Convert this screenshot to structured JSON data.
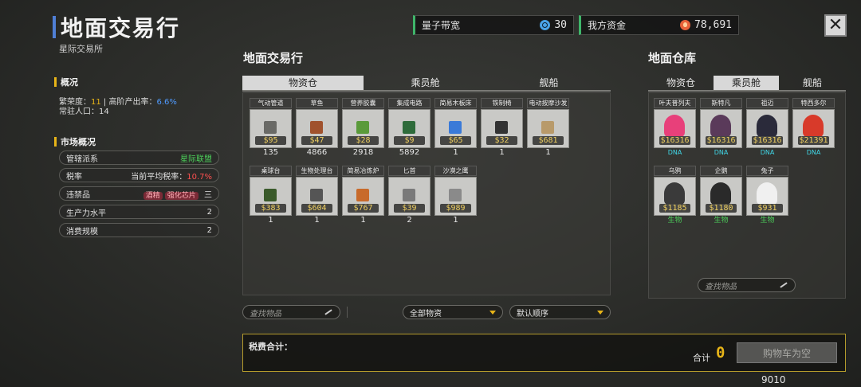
{
  "header": {
    "title": "地面交易行",
    "subtitle": "星际交易所"
  },
  "overview": {
    "heading": "概况",
    "prosperity_label": "繁荣度：",
    "prosperity_value": "11",
    "separator": "|",
    "high_rate_label": "高阶产出率：",
    "high_rate_value": "6.6%",
    "population_label": "常驻人口：",
    "population_value": "14"
  },
  "market": {
    "heading": "市场概况",
    "rows": [
      {
        "label": "管辖派系",
        "value": "星际联盟"
      },
      {
        "label": "税率",
        "value_label": "当前平均税率：",
        "value": "10.7%"
      },
      {
        "label": "违禁品",
        "tags": [
          "酒精",
          "强化芯片"
        ],
        "extra": "三"
      },
      {
        "label": "生产力水平",
        "value": "2"
      },
      {
        "label": "消费规模",
        "value": "2"
      }
    ]
  },
  "topbar": {
    "bandwidth_label": "量子带宽",
    "bandwidth_value": "30",
    "funds_label": "我方资金",
    "funds_value": "78,691",
    "close_glyph": "✕"
  },
  "exchange": {
    "title": "地面交易行",
    "tabs": [
      "物资仓",
      "乘员舱",
      "舰船"
    ],
    "active_tab": 0,
    "items": [
      {
        "name": "气动管道",
        "price": "$95",
        "qty": "135",
        "icon": "pipe-icon",
        "color": "#6a6a66"
      },
      {
        "name": "草鱼",
        "price": "$47",
        "qty": "4866",
        "icon": "fish-icon",
        "color": "#a0522d"
      },
      {
        "name": "营养胶囊",
        "price": "$28",
        "qty": "2918",
        "icon": "capsule-icon",
        "color": "#5a9a3a"
      },
      {
        "name": "集成电路",
        "price": "$9",
        "qty": "5892",
        "icon": "chip-icon",
        "color": "#2e6b3a"
      },
      {
        "name": "简易木板床",
        "price": "$65",
        "qty": "1",
        "icon": "bed-icon",
        "color": "#3a7ad8"
      },
      {
        "name": "铁制椅",
        "price": "$32",
        "qty": "1",
        "icon": "chair-icon",
        "color": "#333333"
      },
      {
        "name": "电动按摩沙发",
        "price": "$681",
        "qty": "1",
        "icon": "sofa-icon",
        "color": "#b89a6a"
      },
      {
        "name": "桌球台",
        "price": "$383",
        "qty": "1",
        "icon": "pool-table-icon",
        "color": "#3a5a2a"
      },
      {
        "name": "生物处理台",
        "price": "$604",
        "qty": "1",
        "icon": "bio-station-icon",
        "color": "#555555"
      },
      {
        "name": "简易冶炼炉",
        "price": "$767",
        "qty": "1",
        "icon": "furnace-icon",
        "color": "#c86a2a"
      },
      {
        "name": "匕首",
        "price": "$39",
        "qty": "2",
        "icon": "dagger-icon",
        "color": "#7a7a7a"
      },
      {
        "name": "沙漠之鹰",
        "price": "$989",
        "qty": "1",
        "icon": "pistol-icon",
        "color": "#8a8a8a"
      }
    ],
    "search_placeholder": "查找物品",
    "filter_value": "全部物资",
    "sort_value": "默认顺序"
  },
  "warehouse": {
    "title": "地面仓库",
    "tabs": [
      "物资仓",
      "乘员舱",
      "舰船"
    ],
    "active_tab": 1,
    "crew": [
      {
        "name": "叶夫普列夫",
        "price": "$16316",
        "tag": "DNA",
        "icon": "pink-hair-portrait-icon",
        "color": "#e8407a"
      },
      {
        "name": "斯特凡",
        "price": "$16316",
        "tag": "DNA",
        "icon": "dark-hair-portrait-icon",
        "color": "#5a3a5a"
      },
      {
        "name": "祖迈",
        "price": "$16316",
        "tag": "DNA",
        "icon": "dark-hair-portrait-icon",
        "color": "#2a2a3a"
      },
      {
        "name": "特西多尔",
        "price": "$21391",
        "tag": "DNA",
        "icon": "red-hair-portrait-icon",
        "color": "#d83a2a"
      },
      {
        "name": "乌鸦",
        "price": "$1185",
        "tag": "生物",
        "icon": "crow-icon",
        "color": "#3a3a3a"
      },
      {
        "name": "企鹅",
        "price": "$1180",
        "tag": "生物",
        "icon": "penguin-icon",
        "color": "#2a2a2a"
      },
      {
        "name": "兔子",
        "price": "$931",
        "tag": "生物",
        "icon": "rabbit-icon",
        "color": "#f0f0f0"
      }
    ],
    "search_placeholder": "查找物品"
  },
  "tax": {
    "label": "税费合计：",
    "total_label": "合计",
    "total_value": "0",
    "buy_button": "购物车为空",
    "footer_number": "9010"
  }
}
